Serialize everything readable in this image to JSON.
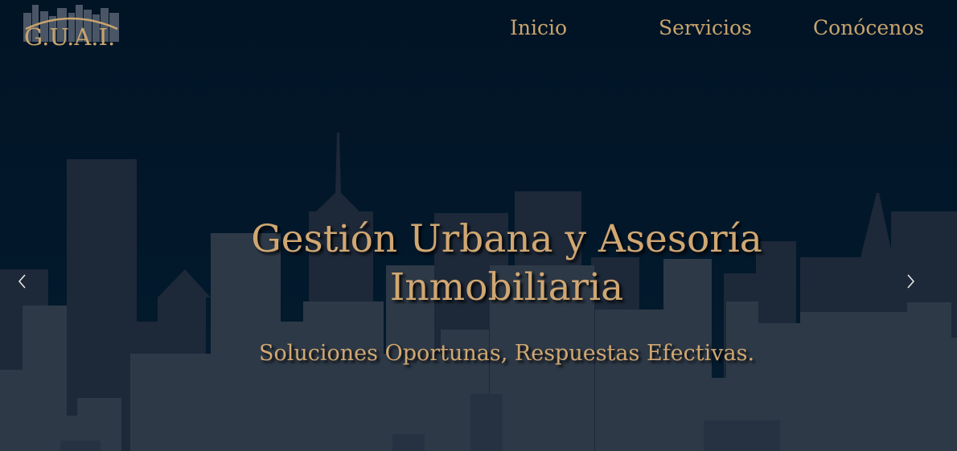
{
  "brand": {
    "logo_text": "G.U.A.I."
  },
  "nav": {
    "items": [
      {
        "label": "Inicio"
      },
      {
        "label": "Servicios"
      },
      {
        "label": "Conócenos"
      }
    ]
  },
  "hero": {
    "title": "Gestión Urbana y Asesoría Inmobiliaria",
    "subtitle": "Soluciones Oportunas, Respuestas Efectivas."
  },
  "carousel": {
    "prev_icon": "chevron-left-icon",
    "next_icon": "chevron-right-icon"
  },
  "colors": {
    "background": "#011426",
    "accent_gold": "#c9a46d",
    "buildings_far": "#1b2737",
    "buildings_near": "#2c3846"
  }
}
